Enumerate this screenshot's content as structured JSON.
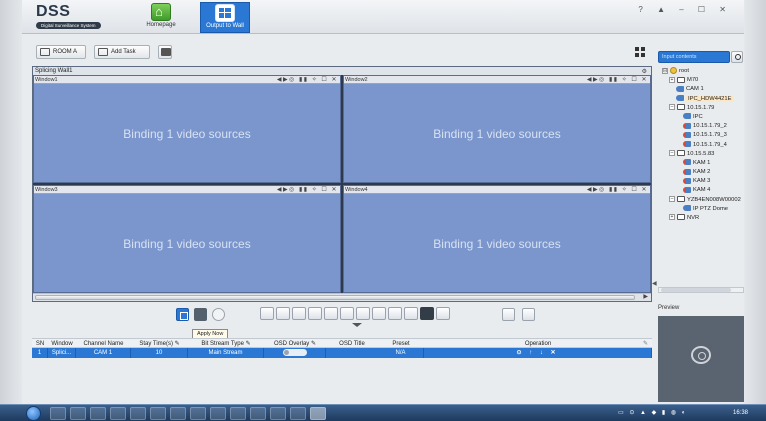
{
  "app": {
    "logo": "DSS",
    "logo_sub": "Digital Surveillance System",
    "window_controls": "? ▲ – ☐ ✕"
  },
  "nav": [
    {
      "label": "Homepage",
      "icon": "home-icon"
    },
    {
      "label": "Output to Wall",
      "icon": "video-wall-icon",
      "active": true
    }
  ],
  "toolbar": {
    "room_label": "ROOM A",
    "add_task_label": "Add Task"
  },
  "wall": {
    "title": "Splicing Wall1",
    "windows": [
      {
        "name": "Window1",
        "content": "Binding 1 video sources"
      },
      {
        "name": "Window2",
        "content": "Binding 1 video sources"
      },
      {
        "name": "Window3",
        "content": "Binding 1 video sources"
      },
      {
        "name": "Window4",
        "content": "Binding 1 video sources"
      }
    ],
    "window_controls": "◀▶◎ ▮▮ ✧ ☐ ✕"
  },
  "tooltip": "Apply Now",
  "table": {
    "headers": [
      "SN",
      "Window",
      "Channel Name",
      "Stay Time(s)",
      "Bit Stream Type",
      "OSD Overlay",
      "OSD Title",
      "Preset",
      "Operation"
    ],
    "rows": [
      {
        "sn": "1",
        "window": "Splici...",
        "channel": "CAM 1",
        "stay": "10",
        "bitstream": "Main Stream",
        "osd_title": "",
        "preset": "N/A",
        "operation": "⊙ ↑ ↓ ✕"
      }
    ]
  },
  "search": {
    "placeholder": "Input contents"
  },
  "tree": [
    {
      "label": "root",
      "level": 0,
      "type": "root",
      "exp": "⊟"
    },
    {
      "label": "M70",
      "level": 1,
      "type": "dev",
      "exp": "+"
    },
    {
      "label": "CAM 1",
      "level": 2,
      "type": "cam"
    },
    {
      "label": "IPC_HDW4421E",
      "level": 2,
      "type": "cam",
      "selected": true
    },
    {
      "label": "10.15.1.79",
      "level": 1,
      "type": "dev",
      "exp": "–"
    },
    {
      "label": "IPC",
      "level": 3,
      "type": "cam"
    },
    {
      "label": "10.15.1.79_2",
      "level": 3,
      "type": "camred"
    },
    {
      "label": "10.15.1.79_3",
      "level": 3,
      "type": "camred"
    },
    {
      "label": "10.15.1.79_4",
      "level": 3,
      "type": "camred"
    },
    {
      "label": "10.15.5.83",
      "level": 1,
      "type": "dev",
      "exp": "–"
    },
    {
      "label": "KAM 1",
      "level": 3,
      "type": "camred"
    },
    {
      "label": "KAM 2",
      "level": 3,
      "type": "camred"
    },
    {
      "label": "KAM 3",
      "level": 3,
      "type": "camred"
    },
    {
      "label": "KAM 4",
      "level": 3,
      "type": "camred"
    },
    {
      "label": "YZB4EN008W00002",
      "level": 1,
      "type": "dev",
      "exp": "–"
    },
    {
      "label": "IP PTZ Dome",
      "level": 3,
      "type": "cam"
    },
    {
      "label": "NVR",
      "level": 1,
      "type": "dev",
      "exp": "+"
    }
  ],
  "preview": {
    "label": "Preview"
  },
  "taskbar": {
    "clock": "16:38"
  }
}
